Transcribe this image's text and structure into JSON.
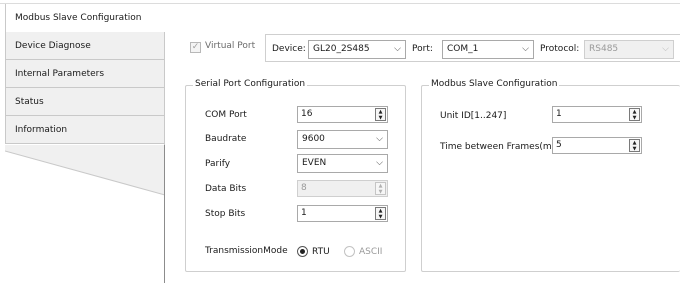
{
  "nav": {
    "items": [
      {
        "label": "Modbus Slave Configuration"
      },
      {
        "label": "Device Diagnose"
      },
      {
        "label": "Internal Parameters"
      },
      {
        "label": "Status"
      },
      {
        "label": "Information"
      }
    ]
  },
  "toolbar": {
    "virtual_port_label": "Virtual Port",
    "virtual_port_checked": true,
    "device_label": "Device:",
    "device_value": "GL20_2S485",
    "port_label": "Port:",
    "port_value": "COM_1",
    "protocol_label": "Protocol:",
    "protocol_value": "RS485"
  },
  "serial": {
    "title": "Serial Port Configuration",
    "com_port_label": "COM Port",
    "com_port_value": "16",
    "baudrate_label": "Baudrate",
    "baudrate_value": "9600",
    "parity_label": "Parify",
    "parity_value": "EVEN",
    "data_bits_label": "Data Bits",
    "data_bits_value": "8",
    "stop_bits_label": "Stop Bits",
    "stop_bits_value": "1",
    "transmission_label": "TransmissionMode",
    "mode_rtu_label": "RTU",
    "mode_ascii_label": "ASCII",
    "selected_mode": "RTU"
  },
  "slave": {
    "title": "Modbus Slave Configuration",
    "unit_id_label": "Unit ID[1..247]",
    "unit_id_value": "1",
    "time_label": "Time between Frames(ms)",
    "time_value": "5"
  },
  "icons": {
    "dropdown": "chevron-down-icon",
    "spin_up": "spin-up-icon",
    "spin_down": "spin-down-icon",
    "check": "check-icon"
  }
}
